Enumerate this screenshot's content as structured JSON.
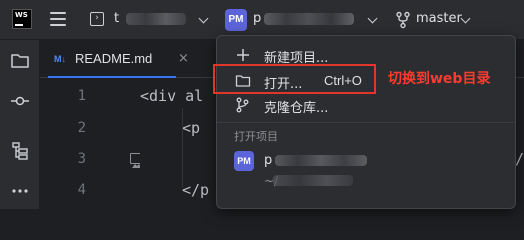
{
  "titlebar": {
    "logo_text": "WS",
    "left_project_prefix": "t",
    "right_project_avatar": "PM",
    "right_project_prefix": "p",
    "branch": "master"
  },
  "editor": {
    "tab_label": "README.md",
    "tab_icon": "M↓",
    "line_numbers": [
      "1",
      "2",
      "3",
      "4"
    ],
    "code_lines": [
      "<div al",
      "<p",
      "</p"
    ],
    "code_remnant": "s/"
  },
  "popup": {
    "items": [
      {
        "label": "新建项目...",
        "shortcut": ""
      },
      {
        "label": "打开...",
        "shortcut": "Ctrl+O"
      },
      {
        "label": "克隆仓库...",
        "shortcut": ""
      }
    ],
    "section_header": "打开项目",
    "recent_project": {
      "avatar": "PM",
      "name_prefix": "p",
      "path_prefix": "~/"
    }
  },
  "annotation": {
    "text": "切换到web目录",
    "color": "#ff3b2f"
  },
  "colors": {
    "accent": "#3574f0",
    "avatar": "#5c64d9",
    "highlight": "#e0362b"
  }
}
